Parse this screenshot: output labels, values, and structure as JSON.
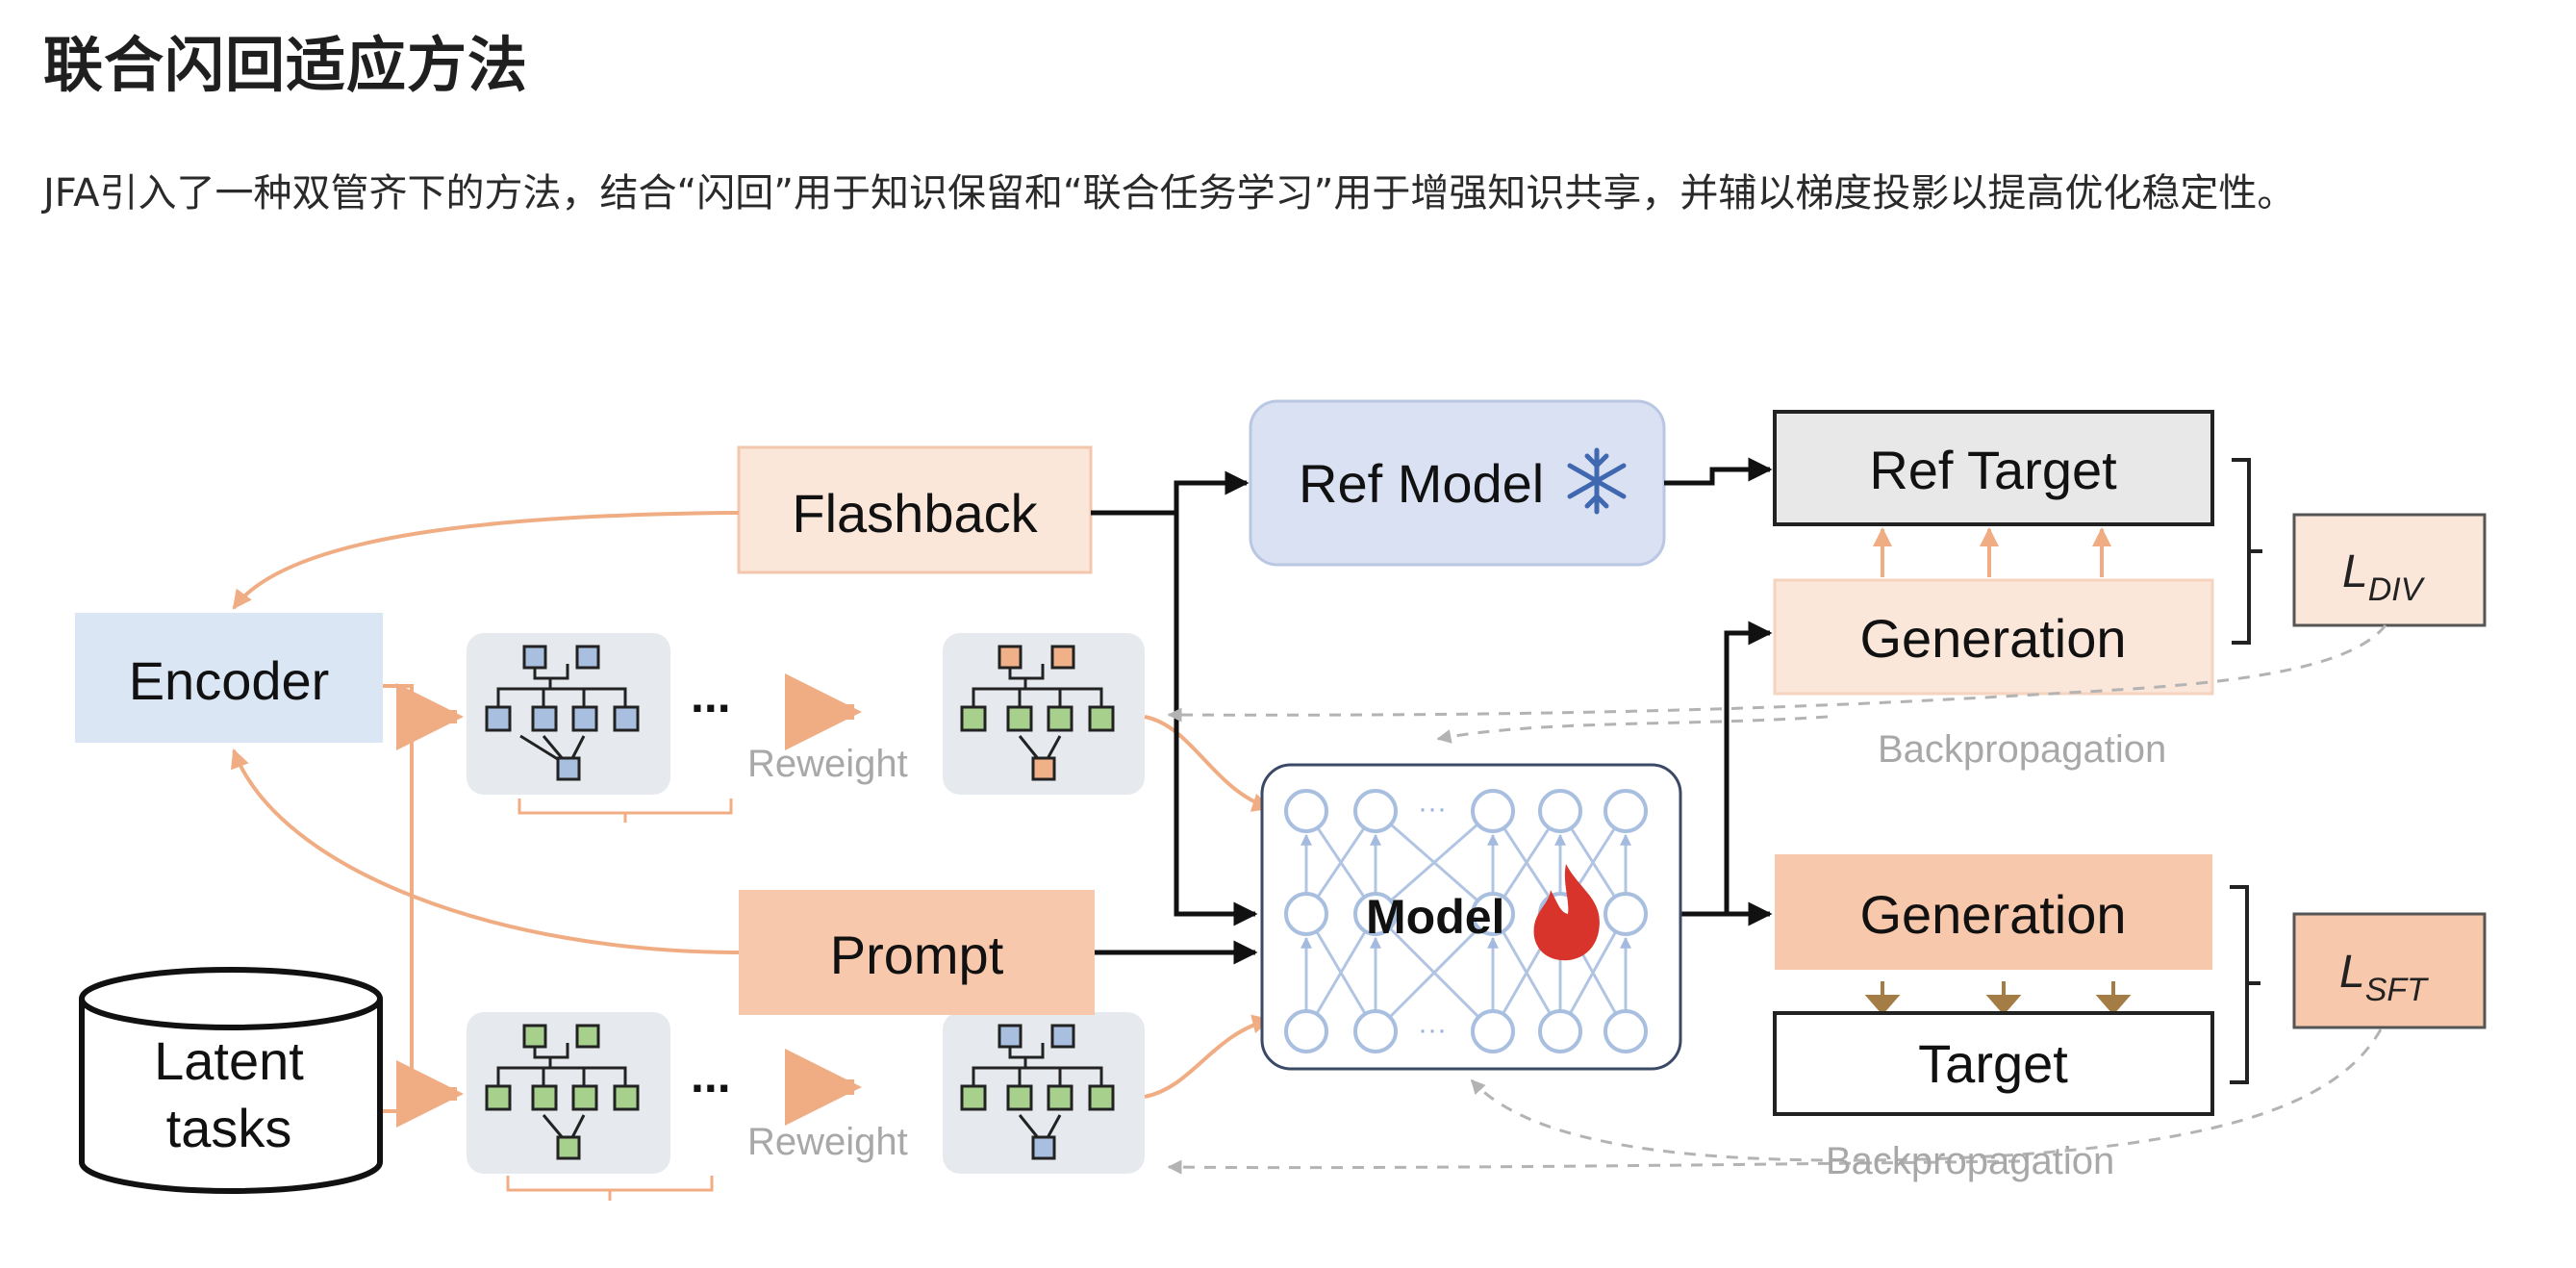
{
  "page": {
    "title": "联合闪回适应方法",
    "description": "JFA引入了一种双管齐下的方法，结合“闪回”用于知识保留和“联合任务学习”用于增强知识共享，并辅以梯度投影以提高优化稳定性。"
  },
  "figure": {
    "flashback": "Flashback",
    "ref_model": "Ref Model",
    "ref_target": "Ref Target",
    "generation_top": "Generation",
    "loss_div": {
      "base": "L",
      "sub": "DIV"
    },
    "encoder": "Encoder",
    "ellipsis": "...",
    "reweight": "Reweight",
    "backprop": "Backpropagation",
    "model": "Model",
    "prompt": "Prompt",
    "generation_bottom": "Generation",
    "target": "Target",
    "loss_sft": {
      "base": "L",
      "sub": "SFT"
    },
    "latent_tasks_line1": "Latent",
    "latent_tasks_line2": "tasks",
    "icons": [
      "snowflake-icon",
      "flame-icon"
    ],
    "colors": {
      "peach_light": "#fbe6da",
      "peach": "#f7c8ac",
      "orange_arrow": "#f0ad83",
      "blue_light": "#dbe6f4",
      "ref_model_fill": "#d9e1f2",
      "node_blue": "#a9bfe0",
      "node_green": "#a8d08d",
      "node_orange": "#f0b189",
      "gray_box": "#e8e8e8",
      "dashed_gray": "#b3b3b3",
      "brown_arrow": "#a47c45"
    }
  }
}
